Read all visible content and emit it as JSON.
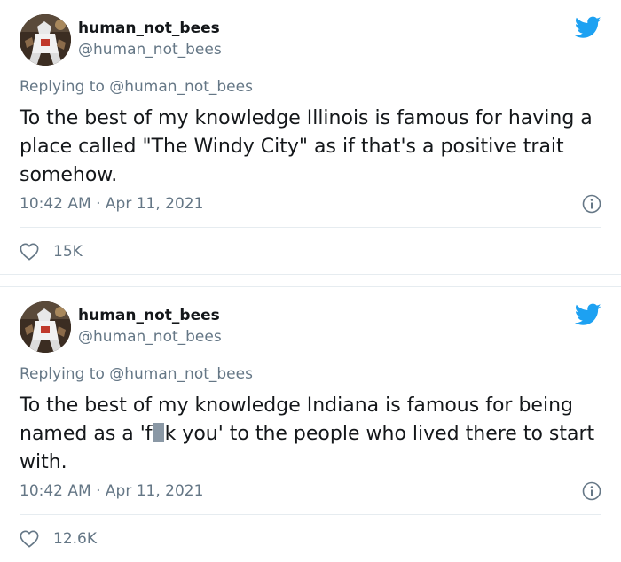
{
  "colors": {
    "twitter_blue": "#1da1f2",
    "secondary_text": "#657786",
    "primary_text": "#14171a",
    "censor_block": "#8a98a5"
  },
  "tweets": [
    {
      "display_name": "human_not_bees",
      "handle": "@human_not_bees",
      "replying_to": "Replying to @human_not_bees",
      "text": "To the best of my knowledge Illinois is famous for having a place called \"The Windy City\" as if that's a positive trait somehow.",
      "timestamp": "10:42 AM · Apr 11, 2021",
      "likes": "15K",
      "icons": [
        "avatar",
        "twitter-bird-icon",
        "info-icon",
        "heart-icon"
      ]
    },
    {
      "display_name": "human_not_bees",
      "handle": "@human_not_bees",
      "replying_to": "Replying to @human_not_bees",
      "text_before": "To the best of my knowledge Indiana is famous for being named as a 'f",
      "text_after": "k you' to the people who lived there to start with.",
      "timestamp": "10:42 AM · Apr 11, 2021",
      "likes": "12.6K",
      "icons": [
        "avatar",
        "twitter-bird-icon",
        "info-icon",
        "heart-icon"
      ]
    }
  ]
}
